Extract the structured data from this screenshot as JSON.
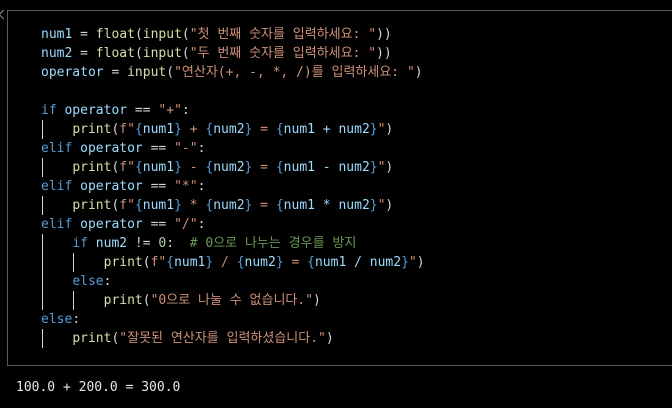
{
  "editor": {
    "lines": [
      [
        {
          "t": "num1",
          "c": "var"
        },
        {
          "t": " = ",
          "c": "op"
        },
        {
          "t": "float",
          "c": "fn"
        },
        {
          "t": "(",
          "c": "op"
        },
        {
          "t": "input",
          "c": "fn"
        },
        {
          "t": "(",
          "c": "op"
        },
        {
          "t": "\"첫 번째 숫자를 입력하세요: \"",
          "c": "str"
        },
        {
          "t": "))",
          "c": "op"
        }
      ],
      [
        {
          "t": "num2",
          "c": "var"
        },
        {
          "t": " = ",
          "c": "op"
        },
        {
          "t": "float",
          "c": "fn"
        },
        {
          "t": "(",
          "c": "op"
        },
        {
          "t": "input",
          "c": "fn"
        },
        {
          "t": "(",
          "c": "op"
        },
        {
          "t": "\"두 번째 숫자를 입력하세요: \"",
          "c": "str"
        },
        {
          "t": "))",
          "c": "op"
        }
      ],
      [
        {
          "t": "operator",
          "c": "var"
        },
        {
          "t": " = ",
          "c": "op"
        },
        {
          "t": "input",
          "c": "fn"
        },
        {
          "t": "(",
          "c": "op"
        },
        {
          "t": "\"연산자(+, -, *, /)를 입력하세요: \"",
          "c": "str"
        },
        {
          "t": ")",
          "c": "op"
        }
      ],
      [],
      [
        {
          "t": "if",
          "c": "kw"
        },
        {
          "t": " operator",
          "c": "var"
        },
        {
          "t": " == ",
          "c": "op"
        },
        {
          "t": "\"+\"",
          "c": "str"
        },
        {
          "t": ":",
          "c": "op"
        }
      ],
      [
        {
          "t": "    "
        },
        {
          "t": "print",
          "c": "fn"
        },
        {
          "t": "(",
          "c": "op"
        },
        {
          "t": "f\"",
          "c": "str"
        },
        {
          "t": "{",
          "c": "brace"
        },
        {
          "t": "num1",
          "c": "var"
        },
        {
          "t": "}",
          "c": "brace"
        },
        {
          "t": " + ",
          "c": "str"
        },
        {
          "t": "{",
          "c": "brace"
        },
        {
          "t": "num2",
          "c": "var"
        },
        {
          "t": "}",
          "c": "brace"
        },
        {
          "t": " = ",
          "c": "str"
        },
        {
          "t": "{",
          "c": "brace"
        },
        {
          "t": "num1 + num2",
          "c": "var"
        },
        {
          "t": "}",
          "c": "brace"
        },
        {
          "t": "\"",
          "c": "str"
        },
        {
          "t": ")",
          "c": "op"
        }
      ],
      [
        {
          "t": "elif",
          "c": "kw"
        },
        {
          "t": " operator",
          "c": "var"
        },
        {
          "t": " == ",
          "c": "op"
        },
        {
          "t": "\"-\"",
          "c": "str"
        },
        {
          "t": ":",
          "c": "op"
        }
      ],
      [
        {
          "t": "    "
        },
        {
          "t": "print",
          "c": "fn"
        },
        {
          "t": "(",
          "c": "op"
        },
        {
          "t": "f\"",
          "c": "str"
        },
        {
          "t": "{",
          "c": "brace"
        },
        {
          "t": "num1",
          "c": "var"
        },
        {
          "t": "}",
          "c": "brace"
        },
        {
          "t": " - ",
          "c": "str"
        },
        {
          "t": "{",
          "c": "brace"
        },
        {
          "t": "num2",
          "c": "var"
        },
        {
          "t": "}",
          "c": "brace"
        },
        {
          "t": " = ",
          "c": "str"
        },
        {
          "t": "{",
          "c": "brace"
        },
        {
          "t": "num1 - num2",
          "c": "var"
        },
        {
          "t": "}",
          "c": "brace"
        },
        {
          "t": "\"",
          "c": "str"
        },
        {
          "t": ")",
          "c": "op"
        }
      ],
      [
        {
          "t": "elif",
          "c": "kw"
        },
        {
          "t": " operator",
          "c": "var"
        },
        {
          "t": " == ",
          "c": "op"
        },
        {
          "t": "\"*\"",
          "c": "str"
        },
        {
          "t": ":",
          "c": "op"
        }
      ],
      [
        {
          "t": "    "
        },
        {
          "t": "print",
          "c": "fn"
        },
        {
          "t": "(",
          "c": "op"
        },
        {
          "t": "f\"",
          "c": "str"
        },
        {
          "t": "{",
          "c": "brace"
        },
        {
          "t": "num1",
          "c": "var"
        },
        {
          "t": "}",
          "c": "brace"
        },
        {
          "t": " * ",
          "c": "str"
        },
        {
          "t": "{",
          "c": "brace"
        },
        {
          "t": "num2",
          "c": "var"
        },
        {
          "t": "}",
          "c": "brace"
        },
        {
          "t": " = ",
          "c": "str"
        },
        {
          "t": "{",
          "c": "brace"
        },
        {
          "t": "num1 * num2",
          "c": "var"
        },
        {
          "t": "}",
          "c": "brace"
        },
        {
          "t": "\"",
          "c": "str"
        },
        {
          "t": ")",
          "c": "op"
        }
      ],
      [
        {
          "t": "elif",
          "c": "kw"
        },
        {
          "t": " operator",
          "c": "var"
        },
        {
          "t": " == ",
          "c": "op"
        },
        {
          "t": "\"/\"",
          "c": "str"
        },
        {
          "t": ":",
          "c": "op"
        }
      ],
      [
        {
          "t": "    "
        },
        {
          "t": "if",
          "c": "kw"
        },
        {
          "t": " num2",
          "c": "var"
        },
        {
          "t": " != ",
          "c": "op"
        },
        {
          "t": "0",
          "c": "num"
        },
        {
          "t": ":  ",
          "c": "op"
        },
        {
          "t": "# 0으로 나누는 경우를 방지",
          "c": "cm"
        }
      ],
      [
        {
          "t": "        "
        },
        {
          "t": "print",
          "c": "fn"
        },
        {
          "t": "(",
          "c": "op"
        },
        {
          "t": "f\"",
          "c": "str"
        },
        {
          "t": "{",
          "c": "brace"
        },
        {
          "t": "num1",
          "c": "var"
        },
        {
          "t": "}",
          "c": "brace"
        },
        {
          "t": " / ",
          "c": "str"
        },
        {
          "t": "{",
          "c": "brace"
        },
        {
          "t": "num2",
          "c": "var"
        },
        {
          "t": "}",
          "c": "brace"
        },
        {
          "t": " = ",
          "c": "str"
        },
        {
          "t": "{",
          "c": "brace"
        },
        {
          "t": "num1 / num2",
          "c": "var"
        },
        {
          "t": "}",
          "c": "brace"
        },
        {
          "t": "\"",
          "c": "str"
        },
        {
          "t": ")",
          "c": "op"
        }
      ],
      [
        {
          "t": "    "
        },
        {
          "t": "else",
          "c": "kw"
        },
        {
          "t": ":",
          "c": "op"
        }
      ],
      [
        {
          "t": "        "
        },
        {
          "t": "print",
          "c": "fn"
        },
        {
          "t": "(",
          "c": "op"
        },
        {
          "t": "\"0으로 나눌 수 없습니다.\"",
          "c": "str"
        },
        {
          "t": ")",
          "c": "op"
        }
      ],
      [
        {
          "t": "else",
          "c": "kw"
        },
        {
          "t": ":",
          "c": "op"
        }
      ],
      [
        {
          "t": "    "
        },
        {
          "t": "print",
          "c": "fn"
        },
        {
          "t": "(",
          "c": "op"
        },
        {
          "t": "\"잘못된 연산자를 입력하셨습니다.\"",
          "c": "str"
        },
        {
          "t": ")",
          "c": "op"
        }
      ]
    ]
  },
  "output": {
    "text": "100.0 + 200.0 = 300.0"
  },
  "colors": {
    "background": "#000000",
    "keyword": "#569cd6",
    "function": "#dcdcaa",
    "string": "#ce9178",
    "variable": "#9cdcfe",
    "comment": "#6a9955",
    "number": "#b5cea8"
  }
}
